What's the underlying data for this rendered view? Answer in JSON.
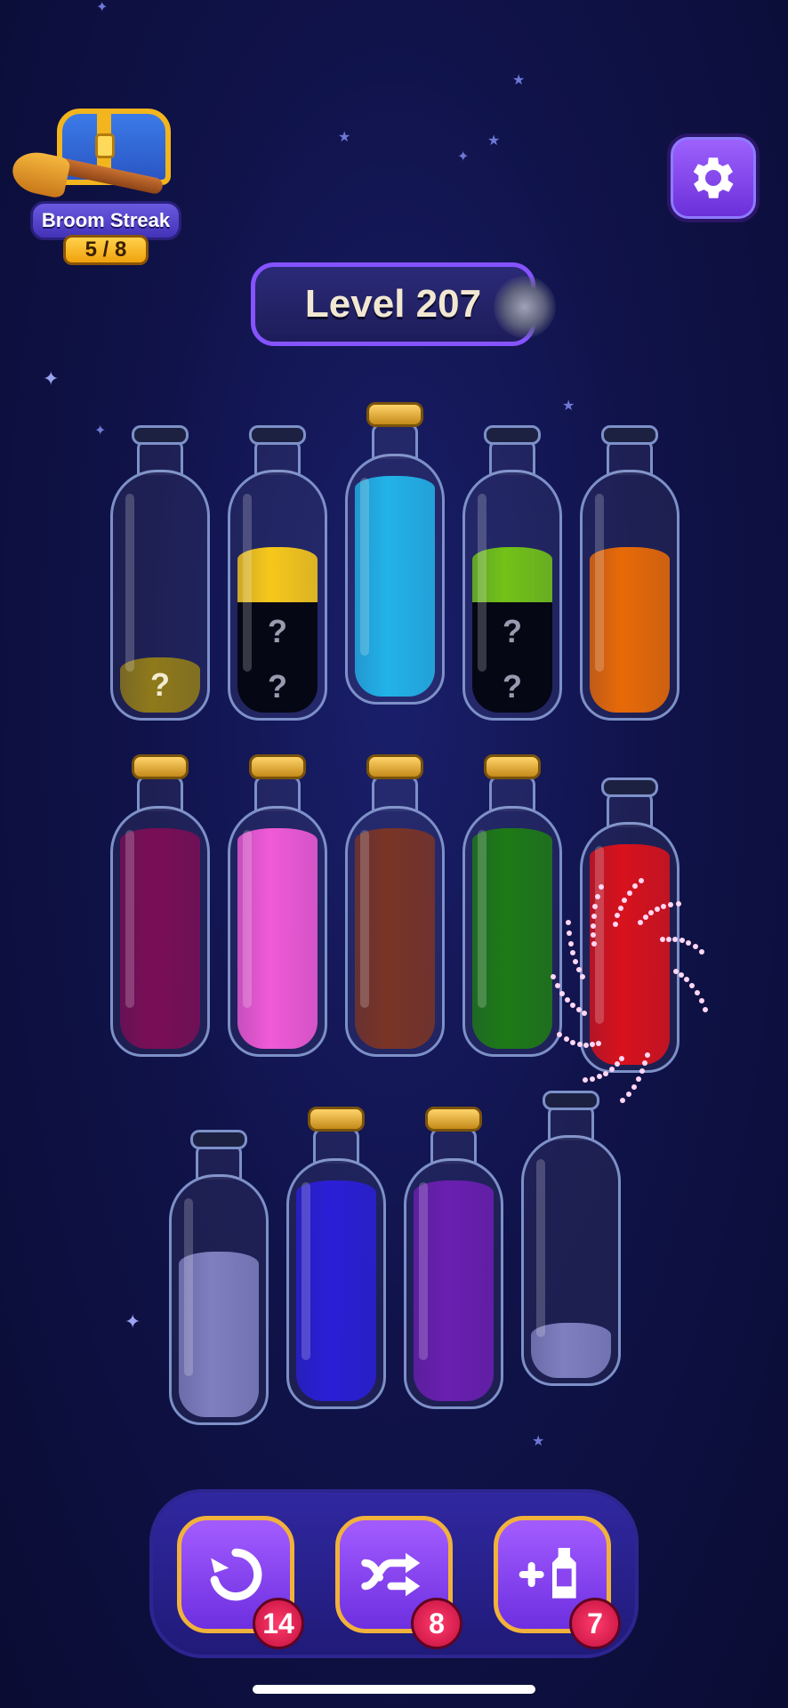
{
  "broom_streak": {
    "label": "Broom Streak",
    "progress": "5 / 8"
  },
  "level": {
    "label": "Level 207"
  },
  "settings": {
    "icon": "gear-icon"
  },
  "colors": {
    "yellow": "#f7c81a",
    "cyan": "#22b3e8",
    "lime": "#72c218",
    "orange": "#e86a07",
    "plum": "#7a0e56",
    "pink": "#f05ad6",
    "brown": "#7a3426",
    "green": "#1e7a16",
    "red": "#d8121c",
    "lavender": "#7f7fc0",
    "blue": "#2a1fd6",
    "purple": "#6a1fb0",
    "mystery": "#8f7a1a"
  },
  "bottles": [
    {
      "id": 1,
      "corked": false,
      "layers": [
        {
          "color": "mystery",
          "hidden": true
        }
      ]
    },
    {
      "id": 2,
      "corked": false,
      "layers": [
        {
          "color": "hidden",
          "hidden": true
        },
        {
          "color": "hidden",
          "hidden": true
        },
        {
          "color": "yellow"
        }
      ]
    },
    {
      "id": 3,
      "corked": true,
      "layers": [
        {
          "color": "cyan"
        },
        {
          "color": "cyan"
        },
        {
          "color": "cyan"
        },
        {
          "color": "cyan"
        }
      ]
    },
    {
      "id": 4,
      "corked": false,
      "layers": [
        {
          "color": "hidden",
          "hidden": true
        },
        {
          "color": "hidden",
          "hidden": true
        },
        {
          "color": "lime"
        }
      ]
    },
    {
      "id": 5,
      "corked": false,
      "layers": [
        {
          "color": "orange"
        },
        {
          "color": "orange"
        },
        {
          "color": "orange"
        }
      ]
    },
    {
      "id": 6,
      "corked": true,
      "layers": [
        {
          "color": "plum"
        },
        {
          "color": "plum"
        },
        {
          "color": "plum"
        },
        {
          "color": "plum"
        }
      ]
    },
    {
      "id": 7,
      "corked": true,
      "layers": [
        {
          "color": "pink"
        },
        {
          "color": "pink"
        },
        {
          "color": "pink"
        },
        {
          "color": "pink"
        }
      ]
    },
    {
      "id": 8,
      "corked": true,
      "layers": [
        {
          "color": "brown"
        },
        {
          "color": "brown"
        },
        {
          "color": "brown"
        },
        {
          "color": "brown"
        }
      ]
    },
    {
      "id": 9,
      "corked": true,
      "layers": [
        {
          "color": "green"
        },
        {
          "color": "green"
        },
        {
          "color": "green"
        },
        {
          "color": "green"
        }
      ]
    },
    {
      "id": 10,
      "corked": false,
      "layers": [
        {
          "color": "red"
        },
        {
          "color": "red"
        },
        {
          "color": "red"
        },
        {
          "color": "red"
        }
      ]
    },
    {
      "id": 11,
      "corked": false,
      "layers": [
        {
          "color": "lavender"
        },
        {
          "color": "lavender"
        },
        {
          "color": "lavender"
        }
      ]
    },
    {
      "id": 12,
      "corked": true,
      "layers": [
        {
          "color": "blue"
        },
        {
          "color": "blue"
        },
        {
          "color": "blue"
        },
        {
          "color": "blue"
        }
      ]
    },
    {
      "id": 13,
      "corked": true,
      "layers": [
        {
          "color": "purple"
        },
        {
          "color": "purple"
        },
        {
          "color": "purple"
        },
        {
          "color": "purple"
        }
      ]
    },
    {
      "id": 14,
      "corked": false,
      "layers": [
        {
          "color": "lavender"
        }
      ]
    }
  ],
  "powerups": {
    "undo": {
      "icon": "undo-icon",
      "count": "14"
    },
    "shuffle": {
      "icon": "shuffle-icon",
      "count": "8"
    },
    "add_bottle": {
      "icon": "add-bottle-icon",
      "count": "7"
    }
  }
}
